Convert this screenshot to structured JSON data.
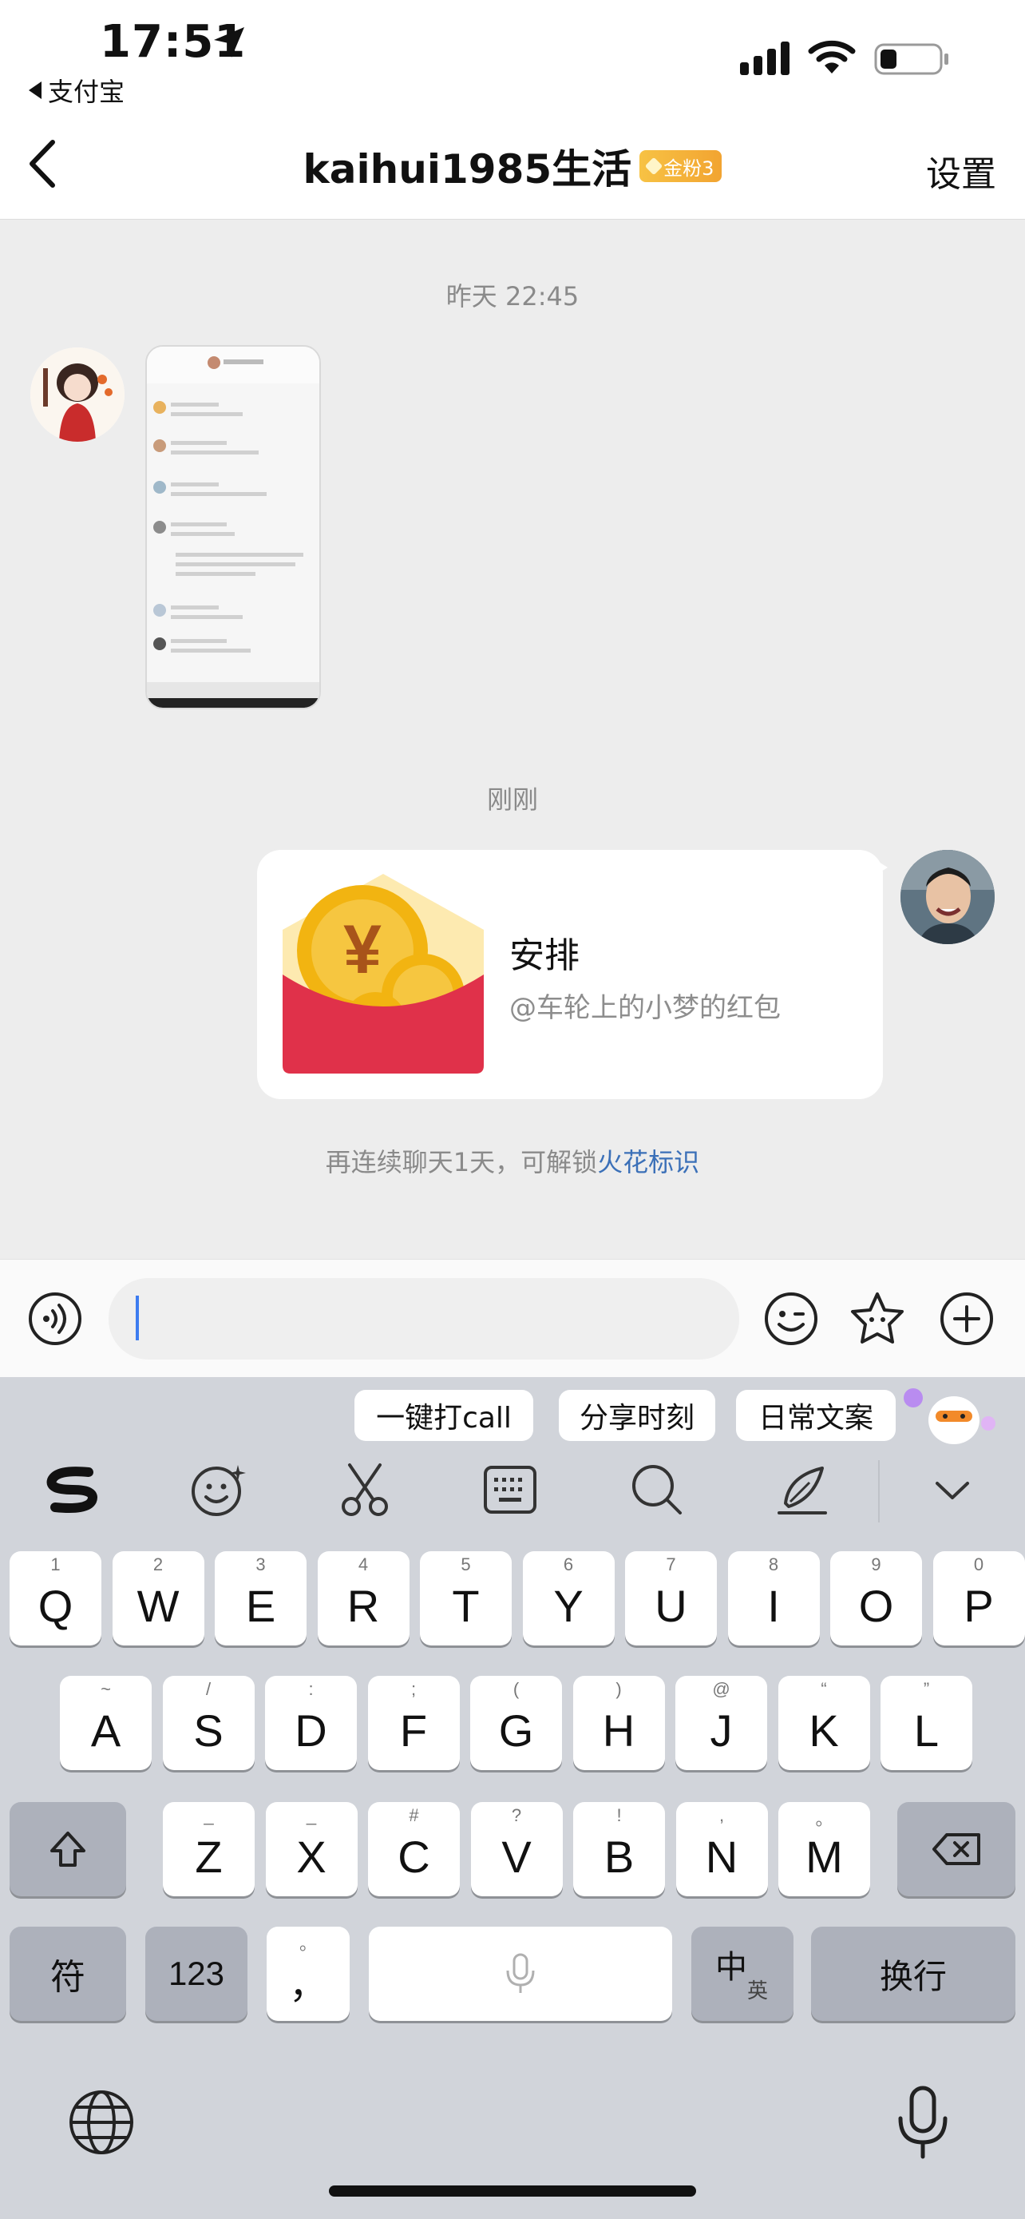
{
  "status_bar": {
    "time": "17:51",
    "back_app": "支付宝"
  },
  "nav": {
    "title": "kaihui1985生活",
    "fan_badge": "金粉3",
    "settings": "设置"
  },
  "chat": {
    "timestamp_1": "昨天 22:45",
    "timestamp_2": "刚刚",
    "red_packet": {
      "title": "安排",
      "subtitle": "@车轮上的小梦的红包"
    },
    "spark_hint_prefix": "再连续聊天1天，可解锁",
    "spark_hint_link": "火花标识"
  },
  "input": {
    "placeholder": ""
  },
  "keyboard": {
    "suggestions": [
      "一键打call",
      "分享时刻",
      "日常文案"
    ],
    "row1": [
      {
        "ch": "Q",
        "sub": "1"
      },
      {
        "ch": "W",
        "sub": "2"
      },
      {
        "ch": "E",
        "sub": "3"
      },
      {
        "ch": "R",
        "sub": "4"
      },
      {
        "ch": "T",
        "sub": "5"
      },
      {
        "ch": "Y",
        "sub": "6"
      },
      {
        "ch": "U",
        "sub": "7"
      },
      {
        "ch": "I",
        "sub": "8"
      },
      {
        "ch": "O",
        "sub": "9"
      },
      {
        "ch": "P",
        "sub": "0"
      }
    ],
    "row2": [
      {
        "ch": "A",
        "sub": "~"
      },
      {
        "ch": "S",
        "sub": "/"
      },
      {
        "ch": "D",
        "sub": ":"
      },
      {
        "ch": "F",
        "sub": ";"
      },
      {
        "ch": "G",
        "sub": "("
      },
      {
        "ch": "H",
        "sub": ")"
      },
      {
        "ch": "J",
        "sub": "@"
      },
      {
        "ch": "K",
        "sub": "“"
      },
      {
        "ch": "L",
        "sub": "”"
      }
    ],
    "row3": [
      {
        "ch": "Z",
        "sub": "_"
      },
      {
        "ch": "X",
        "sub": "_"
      },
      {
        "ch": "C",
        "sub": "#"
      },
      {
        "ch": "V",
        "sub": "?"
      },
      {
        "ch": "B",
        "sub": "!"
      },
      {
        "ch": "N",
        "sub": ","
      },
      {
        "ch": "M",
        "sub": "。"
      }
    ],
    "symbol_key": "符",
    "number_key": "123",
    "punct_key": "，",
    "punct_key_sub": "。",
    "lang_key": "中",
    "lang_key_sub": "英",
    "return_key": "换行"
  },
  "colors": {
    "link": "#3b70b8",
    "red_packet_red": "#e0314a",
    "coin_gold": "#f2b411",
    "badge_gold": "#f2a431",
    "caret": "#3d7cf0"
  }
}
